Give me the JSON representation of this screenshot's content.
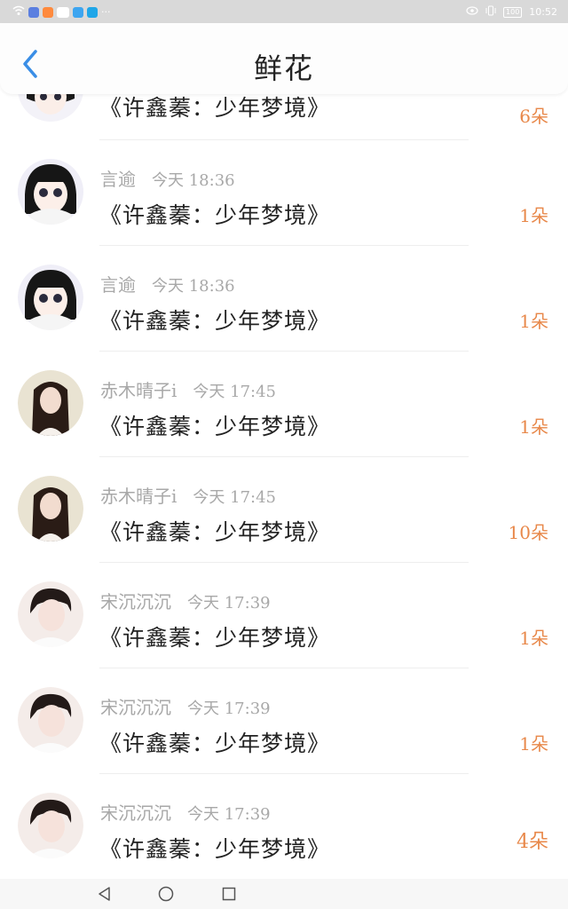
{
  "status_bar": {
    "time": "10:52",
    "battery": "100"
  },
  "header": {
    "title": "鲜花"
  },
  "rows": [
    {
      "name": "",
      "time": "",
      "title": "《许鑫蓁：少年梦境》",
      "count": "6朵"
    },
    {
      "name": "言逾",
      "time": "今天 18:36",
      "title": "《许鑫蓁：少年梦境》",
      "count": "1朵"
    },
    {
      "name": "言逾",
      "time": "今天 18:36",
      "title": "《许鑫蓁：少年梦境》",
      "count": "1朵"
    },
    {
      "name": "赤木晴子i",
      "time": "今天 17:45",
      "title": "《许鑫蓁：少年梦境》",
      "count": "1朵"
    },
    {
      "name": "赤木晴子i",
      "time": "今天 17:45",
      "title": "《许鑫蓁：少年梦境》",
      "count": "10朵"
    },
    {
      "name": "宋沉沉沉",
      "time": "今天 17:39",
      "title": "《许鑫蓁：少年梦境》",
      "count": "1朵"
    },
    {
      "name": "宋沉沉沉",
      "time": "今天 17:39",
      "title": "《许鑫蓁：少年梦境》",
      "count": "1朵"
    },
    {
      "name": "宋沉沉沉",
      "time": "今天 17:39",
      "title": "《许鑫蓁：少年梦境》",
      "count": "4朵"
    }
  ],
  "icons": {
    "back": "chevron-left-icon",
    "nav_back": "triangle-back-icon",
    "nav_home": "circle-home-icon",
    "nav_recent": "square-recent-icon"
  },
  "colors": {
    "accent": "#3a8ee6",
    "count": "#e8884a"
  }
}
